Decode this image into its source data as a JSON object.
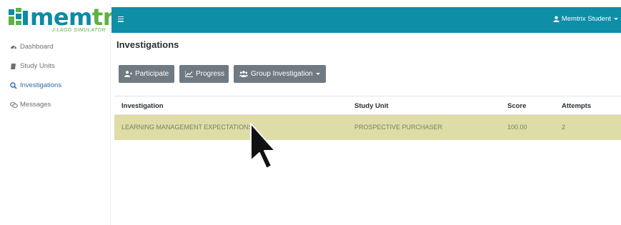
{
  "brand": {
    "name_a": "mem",
    "name_b": "trix",
    "subtitle": "J-LAGG SIMULATOR"
  },
  "sidebar": {
    "items": [
      {
        "label": "Dashboard",
        "icon": "dashboard-icon"
      },
      {
        "label": "Study Units",
        "icon": "book-icon"
      },
      {
        "label": "Investigations",
        "icon": "search-icon",
        "active": true
      },
      {
        "label": "Messages",
        "icon": "chat-icon"
      }
    ]
  },
  "topbar": {
    "user_label": "Memtrix Student",
    "color": "#0f8ea7"
  },
  "main": {
    "title": "Investigations",
    "buttons": {
      "participate": "Participate",
      "progress": "Progress",
      "group": "Group Investigation"
    },
    "table": {
      "headers": [
        "Investigation",
        "Study Unit",
        "Score",
        "Attempts"
      ],
      "rows": [
        [
          "LEARNING MANAGEMENT EXPECTATIONS",
          "PROSPECTIVE PURCHASER",
          "100.00",
          "2"
        ]
      ],
      "highlight_color": "#dedda6"
    }
  }
}
